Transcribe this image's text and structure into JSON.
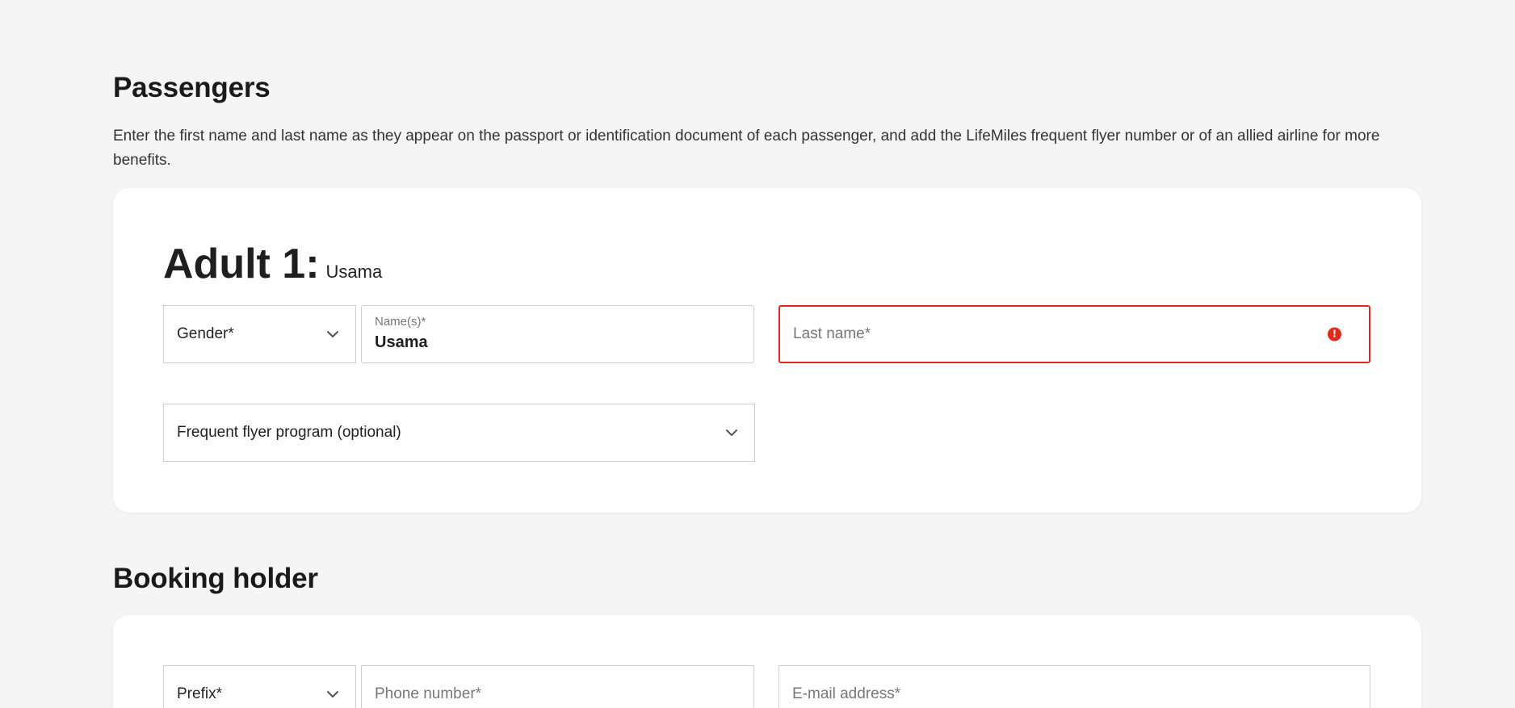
{
  "passengers": {
    "title": "Passengers",
    "description": "Enter the first name and last name as they appear on the passport or identification document of each passenger, and add the LifeMiles frequent flyer number or of an allied airline for more benefits.",
    "adult": {
      "label": "Adult 1:",
      "name": "Usama",
      "gender_placeholder": "Gender*",
      "names_label": "Name(s)*",
      "names_value": "Usama",
      "last_name_placeholder": "Last name*",
      "frequent_flyer_placeholder": "Frequent flyer program (optional)"
    }
  },
  "booking_holder": {
    "title": "Booking holder",
    "prefix_placeholder": "Prefix*",
    "phone_placeholder": "Phone number*",
    "email_placeholder": "E-mail address*"
  },
  "colors": {
    "background": "#f5f5f5",
    "card": "#ffffff",
    "error": "#e02b1b",
    "border": "#cfcfcf"
  },
  "icons": {
    "dropdown": "chevron-down-icon",
    "error": "alert-circle-icon"
  }
}
